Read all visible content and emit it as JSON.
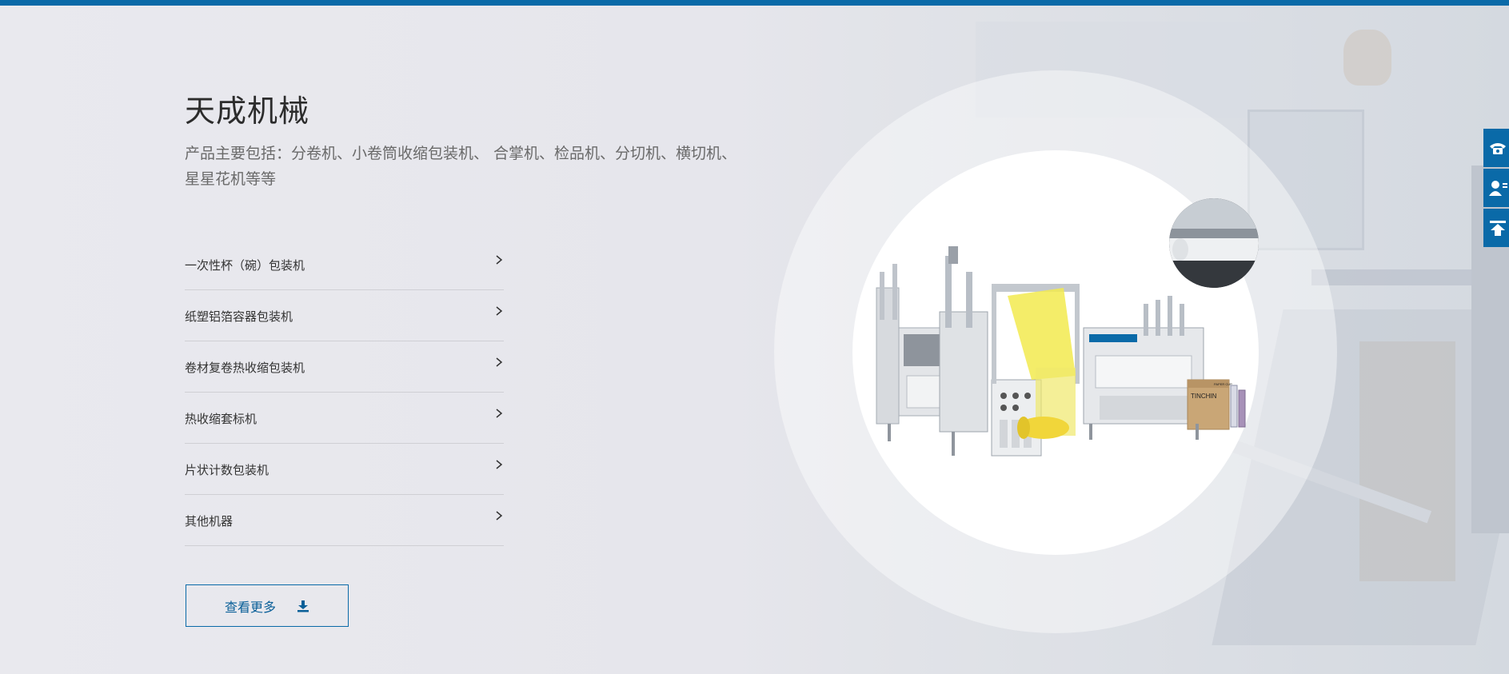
{
  "brand": {
    "title": "天成机械",
    "description": "产品主要包括：分卷机、小卷筒收缩包装机、 合掌机、检品机、分切机、横切机、星星花机等等"
  },
  "categories": [
    {
      "label": "一次性杯（碗）包装机",
      "icon": "chevron-right-icon"
    },
    {
      "label": "纸塑铝箔容器包装机",
      "icon": "chevron-right-icon"
    },
    {
      "label": "卷材复卷热收缩包装机",
      "icon": "chevron-right-icon"
    },
    {
      "label": "热收缩套标机",
      "icon": "chevron-right-icon"
    },
    {
      "label": "片状计数包装机",
      "icon": "chevron-right-icon"
    },
    {
      "label": "其他机器",
      "icon": "chevron-right-icon"
    }
  ],
  "more_button": {
    "label": "查看更多",
    "icon": "download-icon"
  },
  "side_tools": [
    {
      "name": "phone",
      "icon": "phone-icon"
    },
    {
      "name": "contact",
      "icon": "user-icon"
    },
    {
      "name": "back-to-top",
      "icon": "arrow-up-icon"
    }
  ],
  "product_image": {
    "box_brand": "TINCHIN",
    "box_label": "PAPER CUP"
  },
  "colors": {
    "accent": "#0a6aa8",
    "background": "#e7e7ec",
    "title_text": "#2c2c2c",
    "body_text": "#6a6a6a"
  }
}
